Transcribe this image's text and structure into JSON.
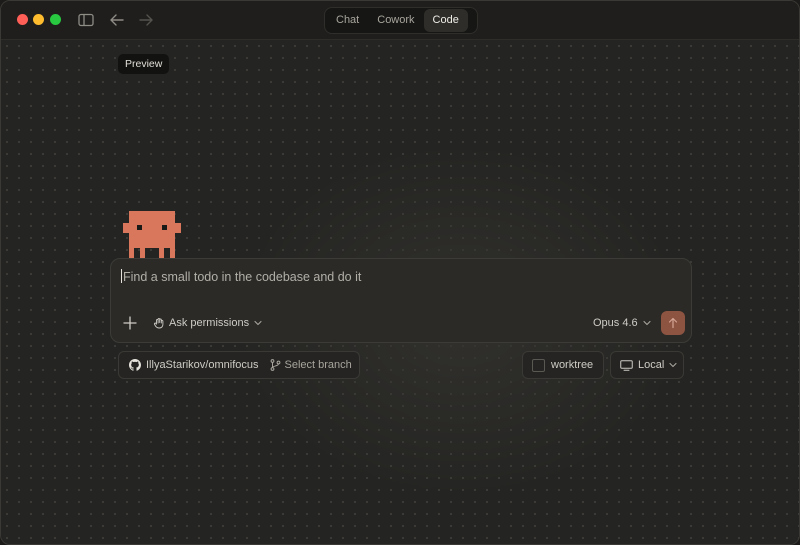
{
  "window": {
    "modes": [
      {
        "label": "Chat",
        "active": false
      },
      {
        "label": "Cowork",
        "active": false
      },
      {
        "label": "Code",
        "active": true
      }
    ]
  },
  "preview_badge": "Preview",
  "composer": {
    "prompt_text": "Find a small todo in the codebase and do it",
    "permission_label": "Ask permissions",
    "model_label": "Opus 4.6"
  },
  "context_bar": {
    "repo": "IllyaStarikov/omnifocus",
    "branch_placeholder": "Select branch",
    "worktree_label": "worktree",
    "worktree_checked": false,
    "environment_label": "Local"
  },
  "icons": {
    "sidebar": "sidebar-toggle-icon",
    "back": "arrow-left-icon",
    "forward": "arrow-right-icon",
    "add": "plus-icon",
    "permission": "hand-icon",
    "send": "arrow-up-icon",
    "repo": "github-icon",
    "branch": "git-branch-icon",
    "environment": "monitor-icon",
    "chevron": "chevron-down-icon"
  },
  "colors": {
    "accent": "#8e5442",
    "mascot": "#d9775c",
    "traffic_close": "#ff5f57",
    "traffic_minimize": "#febc2e",
    "traffic_maximize": "#28c840"
  }
}
